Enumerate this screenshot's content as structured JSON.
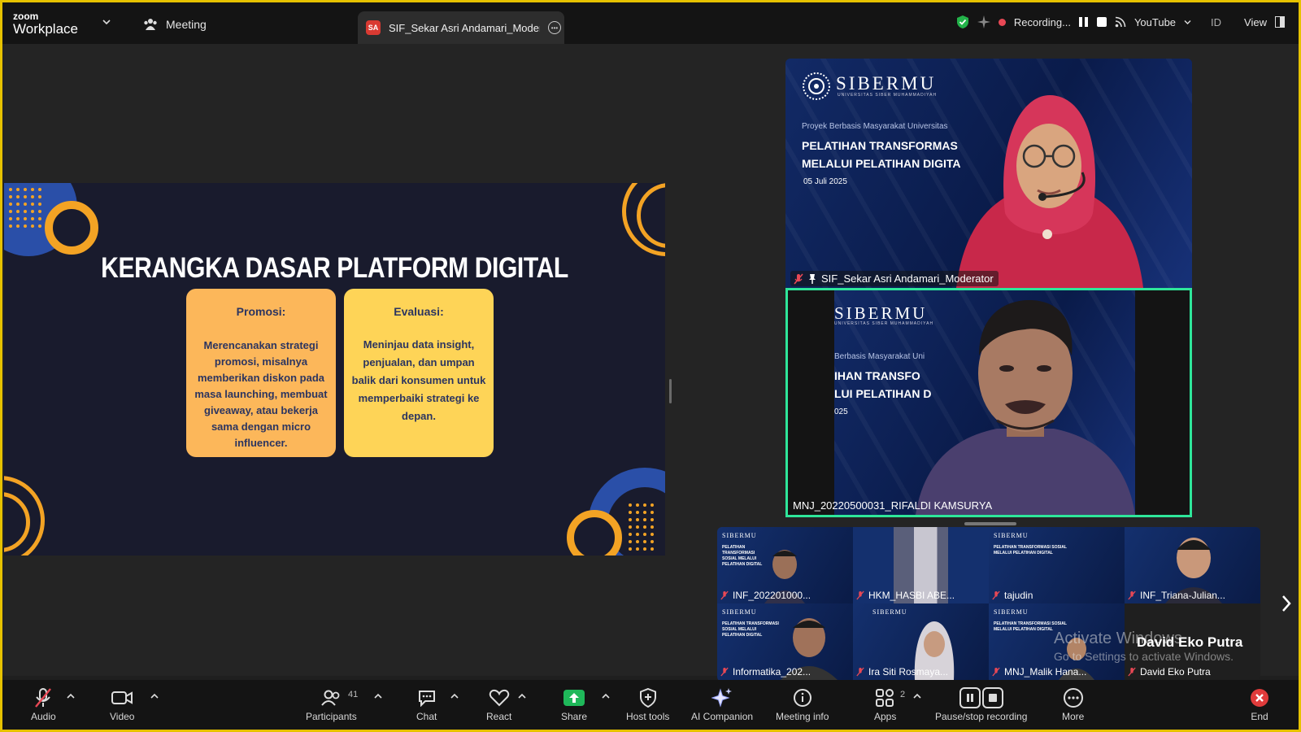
{
  "app": {
    "brand_top": "zoom",
    "brand_name": "Workplace",
    "meeting_label": "Meeting",
    "tab_badge": "SA",
    "tab_title": "SIF_Sekar Asri Andamari_Moderator"
  },
  "status": {
    "recording_label": "Recording...",
    "stream_label": "YouTube",
    "lang": "ID",
    "view_label": "View",
    "colors": {
      "recording": "#e84855",
      "shield": "#23b34a",
      "active_speaker": "#2ee69a",
      "frame": "#e6c200"
    }
  },
  "slide": {
    "title": "KERANGKA DASAR PLATFORM DIGITAL",
    "cards": [
      {
        "heading": "Promosi:",
        "body": "Merencanakan strategi promosi, misalnya memberikan diskon pada masa launching, membuat giveaway, atau bekerja sama dengan micro influencer."
      },
      {
        "heading": "Evaluasi:",
        "body": "Meninjau data insight, penjualan, dan umpan balik dari konsumen untuk memperbaiki strategi ke depan."
      }
    ],
    "colors": {
      "bg": "#191b2d",
      "orange": "#f3a324",
      "blue": "#2a4fa8"
    }
  },
  "tiles": {
    "moderator": {
      "name": "SIF_Sekar Asri Andamari_Moderator",
      "logo": "SIBERMU",
      "logo_sub": "UNIVERSITAS SIBER MUHAMMADIYAH",
      "project": "Proyek Berbasis Masyarakat Universitas",
      "heading_line1": "PELATIHAN TRANSFORMAS",
      "heading_line2": "MELALUI PELATIHAN DIGITA",
      "date": "05 Juli 2025"
    },
    "speaker": {
      "name": "MNJ_20220500031_RIFALDI KAMSURYA",
      "logo": "SIBERMU",
      "logo_sub": "UNIVERSITAS SIBER MUHAMMADIYAH",
      "project": "Berbasis Masyarakat Uni",
      "heading_line1": "IHAN TRANSFO",
      "heading_line2": "LUI PELATIHAN D",
      "date": "025"
    }
  },
  "gallery": {
    "participants": [
      {
        "name": "INF_202201000..."
      },
      {
        "name": "HKM_HASBI ABE..."
      },
      {
        "name": "tajudin"
      },
      {
        "name": "INF_Triana-Julian..."
      },
      {
        "name": "Informatika_202..."
      },
      {
        "name": "Ira Siti Rosmaya..."
      },
      {
        "name": "MNJ_Malik Hana..."
      },
      {
        "name": "David Eko Putra"
      }
    ],
    "mini_logo": "SIBERMU",
    "mini_text": "PELATIHAN TRANSFORMASI SOSIAL MELALUI PELATIHAN DIGITAL",
    "big_name": "David Eko Putra",
    "watermark_title": "Activate Windows",
    "watermark_sub": "Go to Settings to activate Windows."
  },
  "toolbar": {
    "audio": "Audio",
    "video": "Video",
    "participants": "Participants",
    "participants_count": "41",
    "chat": "Chat",
    "react": "React",
    "share": "Share",
    "host_tools": "Host tools",
    "ai_companion": "AI Companion",
    "meeting_info": "Meeting info",
    "apps": "Apps",
    "apps_count": "2",
    "pause_stop": "Pause/stop recording",
    "more": "More",
    "end": "End"
  }
}
